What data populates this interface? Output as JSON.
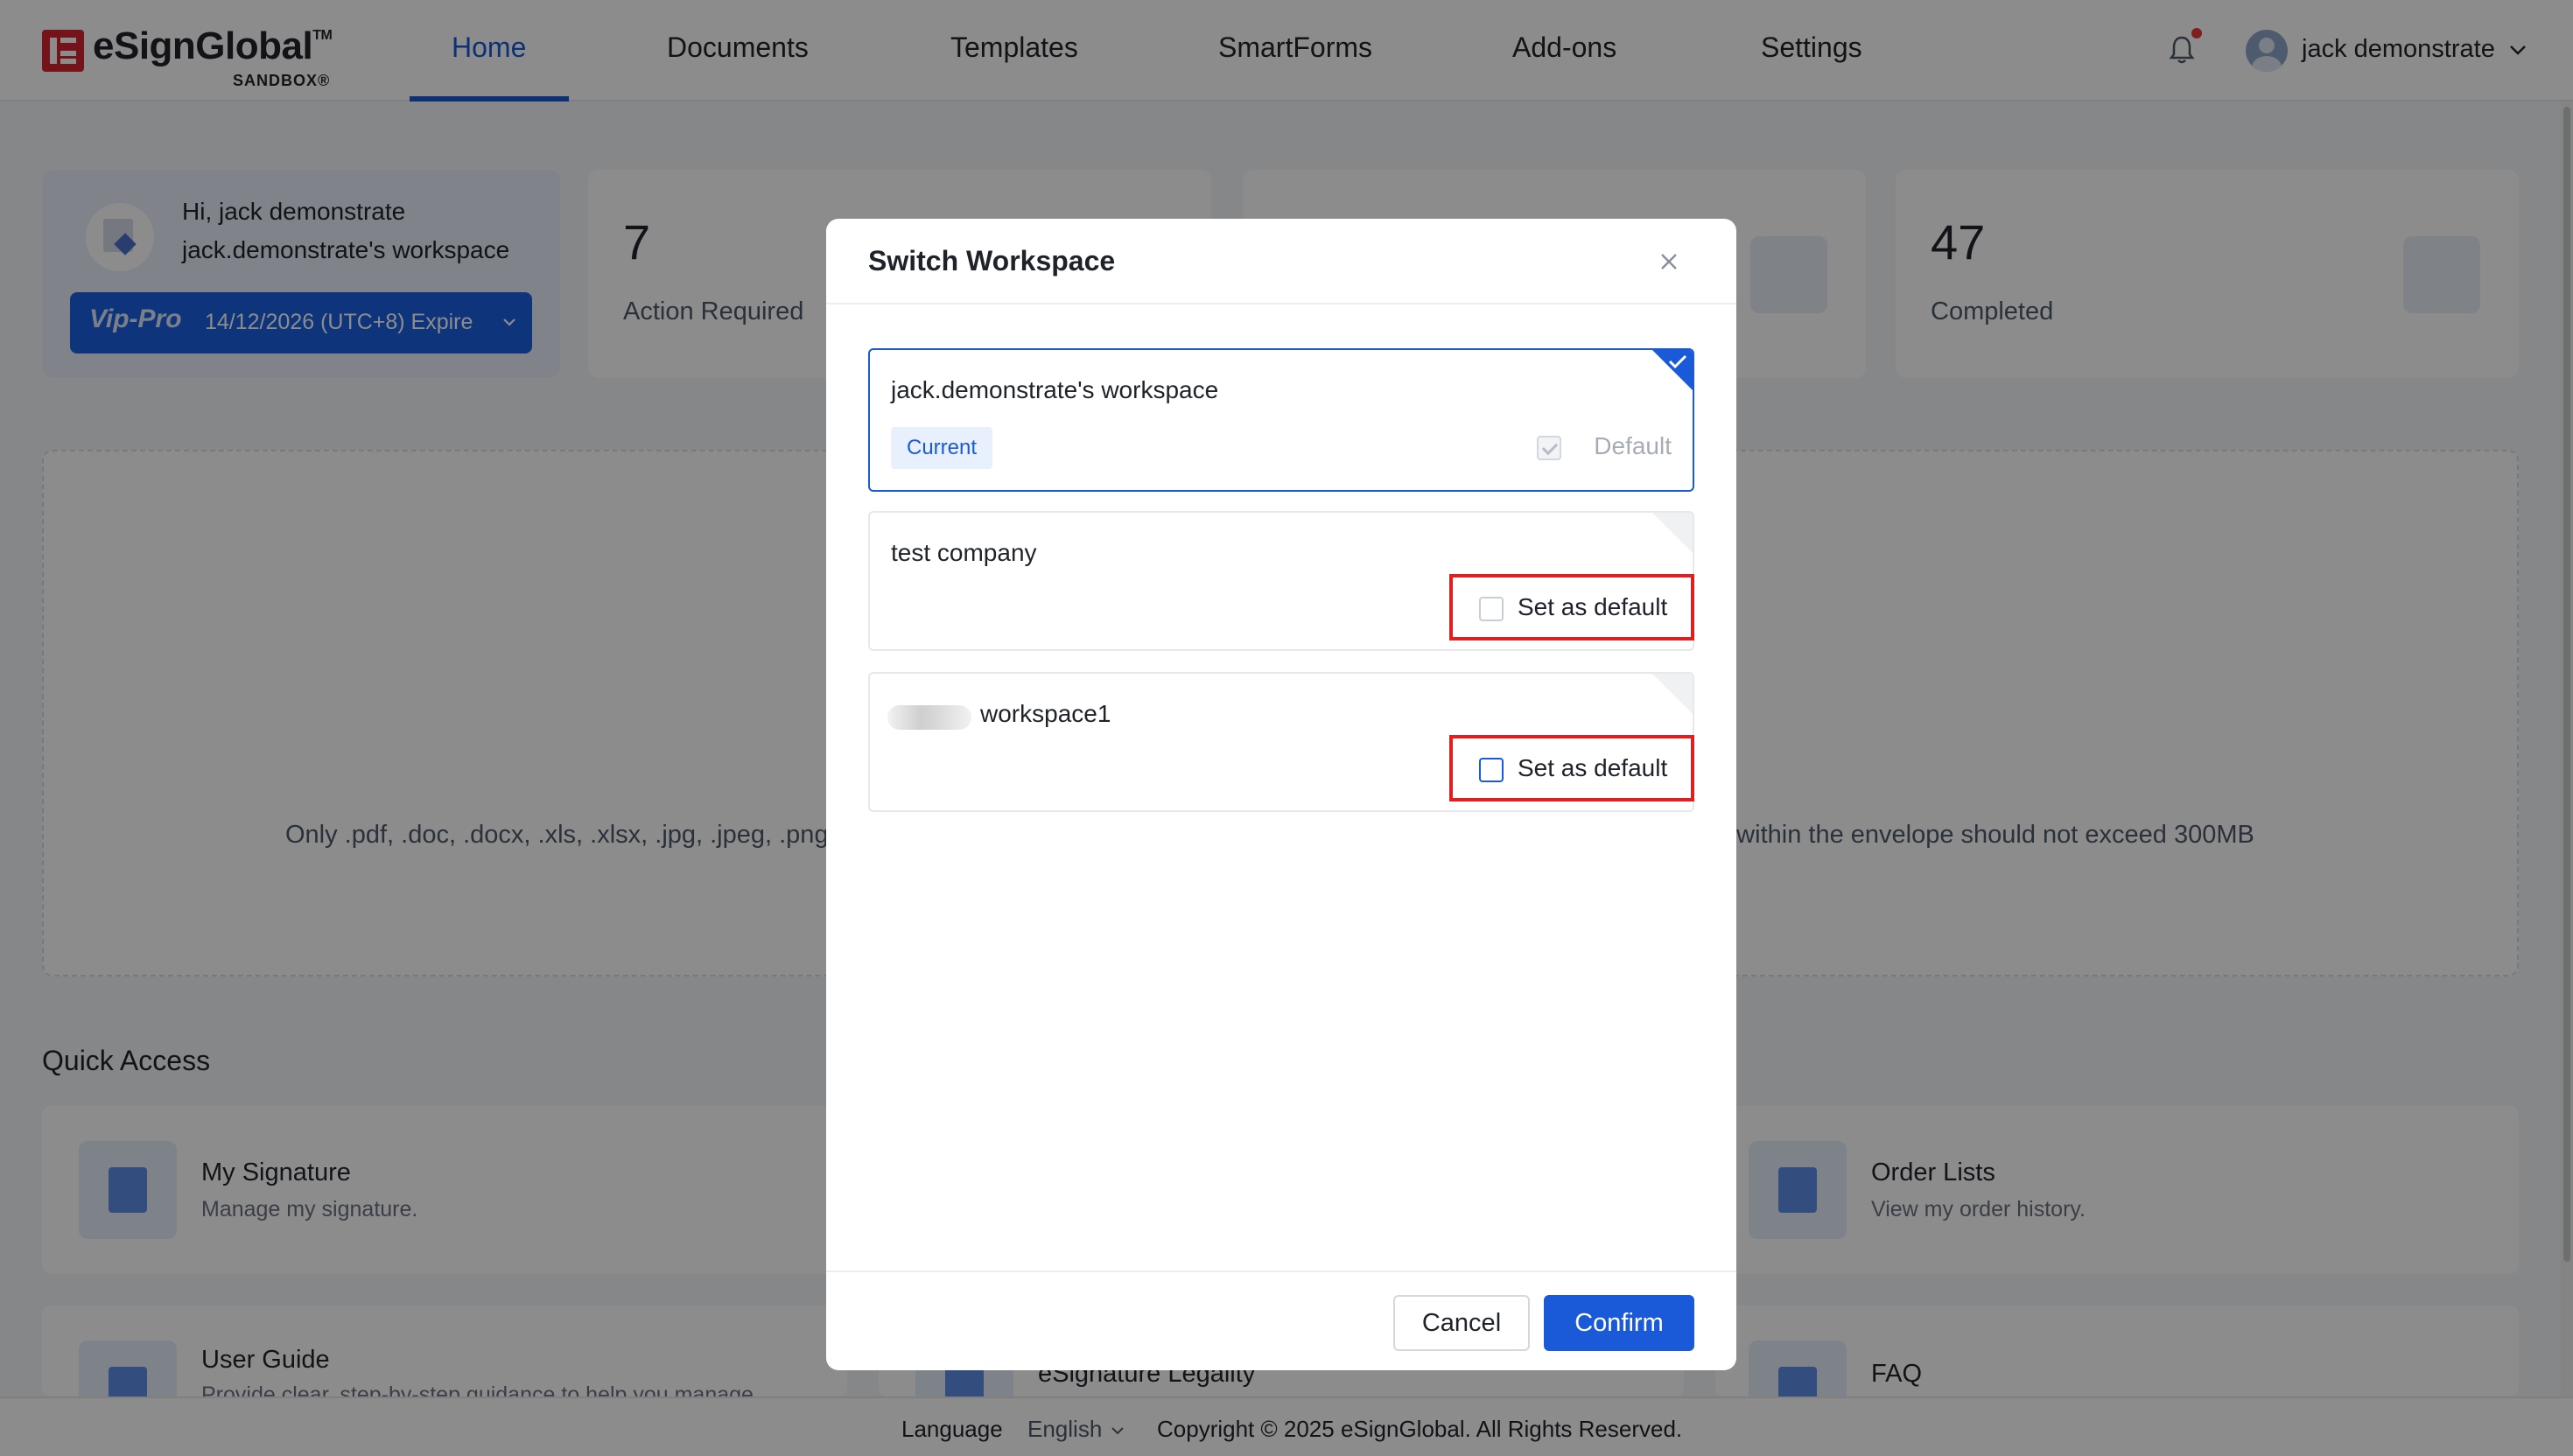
{
  "app": {
    "logo_text": "eSignGlobal",
    "logo_tm": "TM",
    "logo_sub": "SANDBOX"
  },
  "nav": {
    "tabs": [
      {
        "label": "Home",
        "active": true
      },
      {
        "label": "Documents"
      },
      {
        "label": "Templates"
      },
      {
        "label": "SmartForms"
      },
      {
        "label": "Add-ons"
      },
      {
        "label": "Settings"
      }
    ],
    "user_name": "jack demonstrate",
    "notification_unread": true,
    "icons": {
      "bell": "bell-icon",
      "avatar": "user-avatar",
      "caret": "chevron-down-icon"
    }
  },
  "welcome": {
    "greeting": "Hi, jack demonstrate",
    "workspace": "jack.demonstrate's workspace",
    "plan_badge": "Vip-Pro",
    "plan_expire": "14/12/2026 (UTC+8) Expire"
  },
  "stats": [
    {
      "value": "7",
      "label": "Action Required"
    },
    {
      "value": "47",
      "label": "Completed"
    }
  ],
  "upload": {
    "hint_left": "Only .pdf, .doc, .docx, .xls, .xlsx, .jpg, .jpeg, .png",
    "hint_right": "e within the envelope should not exceed 300MB"
  },
  "quick_access": {
    "title": "Quick Access",
    "items": [
      {
        "title": "My Signature",
        "sub": "Manage my signature."
      },
      {
        "title": "Order Lists",
        "sub": "View my order history."
      },
      {
        "title": "User Guide",
        "sub": "Provide clear, step-by-step guidance to help you manage"
      },
      {
        "title": "eSignature Legality",
        "sub": ""
      },
      {
        "title": "FAQ",
        "sub": ""
      }
    ]
  },
  "footer": {
    "language_label": "Language",
    "language_value": "English",
    "copyright": "Copyright © 2025 eSignGlobal. All Rights Reserved."
  },
  "modal": {
    "title": "Switch Workspace",
    "workspaces": [
      {
        "name": "jack.demonstrate's workspace",
        "current_label": "Current",
        "default_label": "Default",
        "selected": true,
        "is_default": true
      },
      {
        "name": "test company",
        "set_default_label": "Set as default",
        "selected": false
      },
      {
        "name": "workspace1",
        "set_default_label": "Set as default",
        "selected": false
      }
    ],
    "cancel_label": "Cancel",
    "confirm_label": "Confirm"
  },
  "colors": {
    "accent": "#1a5ad8",
    "highlight_box": "#e02020",
    "logo_red": "#d3232f"
  }
}
